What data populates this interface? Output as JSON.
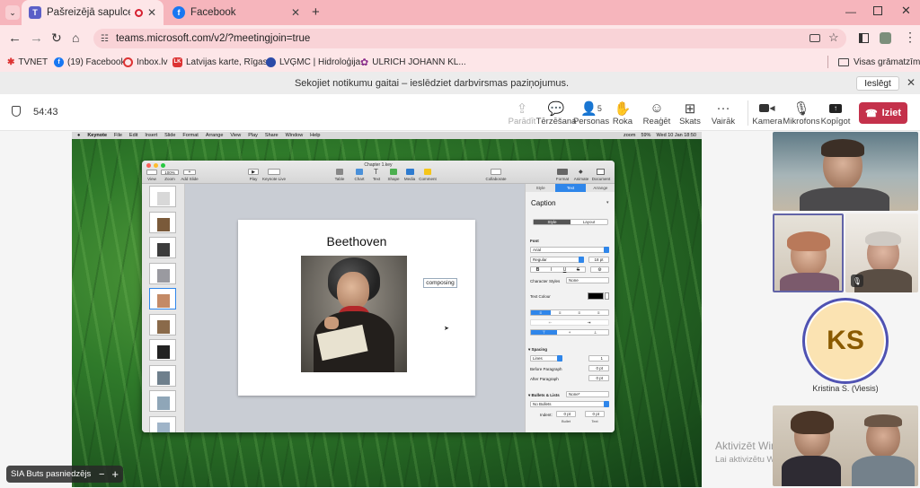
{
  "browser": {
    "tabs": [
      {
        "title": "Pašreizējā sapulce | Micros",
        "active": true,
        "favicon": "teams-icon"
      },
      {
        "title": "Facebook",
        "active": false,
        "favicon": "facebook-icon"
      }
    ],
    "url": "teams.microsoft.com/v2/?meetingjoin=true",
    "bookmarks": [
      {
        "label": "TVNET"
      },
      {
        "label": "(19) Facebook"
      },
      {
        "label": "Inbox.lv"
      },
      {
        "label": "Latvijas karte, Rīgas..."
      },
      {
        "label": "LVĢMC | Hidroloģija..."
      },
      {
        "label": "ULRICH JOHANN KL..."
      }
    ],
    "all_bookmarks_label": "Visas grāmatzīmes"
  },
  "banner": {
    "text": "Sekojiet notikumu gaitai – ieslēdziet darbvirsmas paziņojumus.",
    "button_label": "Ieslēgt"
  },
  "meeting": {
    "timer": "54:43",
    "toolbar": {
      "present": "Parādīt",
      "chat": "Tērzēšana",
      "people": "Personas",
      "people_count": "5",
      "raise": "Roka",
      "react": "Reaģēt",
      "view": "Skats",
      "more": "Vairāk",
      "camera": "Kamera",
      "mic": "Mikrofons",
      "share": "Kopīgot",
      "leave": "Iziet"
    },
    "presenter_label": "SIA Buts pasniedzējs",
    "participant_ks": {
      "initials": "KS",
      "name": "Kristina S. (Viesis)"
    },
    "watermark": {
      "line1": "Aktivizēt Windows",
      "line2": "Lai aktivizētu W"
    }
  },
  "mac_menu": {
    "items": [
      "Keynote",
      "File",
      "Edit",
      "Insert",
      "Slide",
      "Format",
      "Arrange",
      "View",
      "Play",
      "Share",
      "Window",
      "Help"
    ],
    "status": "zoom",
    "battery": "59%",
    "datetime": "Wed 10 Jan  18:50"
  },
  "keynote": {
    "window_title": "Chapter 1.key",
    "toolbar_left": [
      "View",
      "Zoom",
      "Add Slide"
    ],
    "zoom_value": "100%",
    "toolbar_mid": [
      "Play",
      "Keynote Live"
    ],
    "toolbar_insert": [
      "Table",
      "Chart",
      "Text",
      "Shape",
      "Media",
      "Comment"
    ],
    "toolbar_collab": "Collaborate",
    "toolbar_right": [
      "Format",
      "Animate",
      "Document"
    ],
    "slide_title": "Beethoven",
    "slide_textbox": "composing",
    "inspector": {
      "tabs": [
        "Style",
        "Text",
        "Arrange"
      ],
      "active_tab": "Text",
      "paragraph_style": "Caption",
      "subtabs": [
        "Style",
        "Layout"
      ],
      "font_label": "Font",
      "font_name": "Arial",
      "font_style": "Regular",
      "font_size": "18 pt",
      "char_styles_label": "Character Styles",
      "char_styles_value": "None",
      "text_colour_label": "Text Colour",
      "spacing_label": "Spacing",
      "spacing_mode": "Lines",
      "spacing_value": "1",
      "before_para_label": "Before Paragraph",
      "before_para_value": "0 pt",
      "after_para_label": "After Paragraph",
      "after_para_value": "0 pt",
      "bullets_label": "Bullets & Lists",
      "bullets_value": "None*",
      "bullets_select": "No Bullets",
      "indent_label": "Indent:",
      "indent_bullet": "0 pt",
      "indent_text": "0 pt",
      "bullet_caption": "Bullet",
      "text_caption": "Text"
    }
  },
  "colors": {
    "tabstrip": "#f6b5bc",
    "toolbar": "#fde6e8",
    "leave": "#c4314b",
    "ks_ring": "#4f52b2",
    "ks_bg": "#fbe3b2",
    "ks_text": "#8a5a00"
  }
}
